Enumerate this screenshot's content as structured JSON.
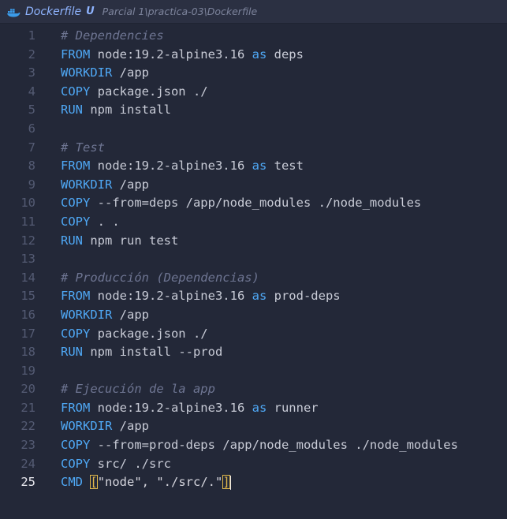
{
  "tab": {
    "filename": "Dockerfile",
    "status": "U",
    "path": "Parcial 1\\practica-03\\Dockerfile"
  },
  "active_line": 25,
  "lines": [
    {
      "n": "1",
      "parts": [
        {
          "t": "cm",
          "v": "# Dependencies"
        }
      ]
    },
    {
      "n": "2",
      "parts": [
        {
          "t": "kw",
          "v": "FROM"
        },
        {
          "t": "txt",
          "v": " node:19.2-alpine3.16 "
        },
        {
          "t": "kw",
          "v": "as"
        },
        {
          "t": "txt",
          "v": " deps"
        }
      ]
    },
    {
      "n": "3",
      "parts": [
        {
          "t": "kw",
          "v": "WORKDIR"
        },
        {
          "t": "txt",
          "v": " /app"
        }
      ]
    },
    {
      "n": "4",
      "parts": [
        {
          "t": "kw",
          "v": "COPY"
        },
        {
          "t": "txt",
          "v": " package.json ./"
        }
      ]
    },
    {
      "n": "5",
      "parts": [
        {
          "t": "kw",
          "v": "RUN"
        },
        {
          "t": "txt",
          "v": " npm install"
        }
      ]
    },
    {
      "n": "6",
      "parts": []
    },
    {
      "n": "7",
      "parts": [
        {
          "t": "cm",
          "v": "# Test"
        }
      ]
    },
    {
      "n": "8",
      "parts": [
        {
          "t": "kw",
          "v": "FROM"
        },
        {
          "t": "txt",
          "v": " node:19.2-alpine3.16 "
        },
        {
          "t": "kw",
          "v": "as"
        },
        {
          "t": "txt",
          "v": " test"
        }
      ]
    },
    {
      "n": "9",
      "parts": [
        {
          "t": "kw",
          "v": "WORKDIR"
        },
        {
          "t": "txt",
          "v": " /app"
        }
      ]
    },
    {
      "n": "10",
      "parts": [
        {
          "t": "kw",
          "v": "COPY"
        },
        {
          "t": "txt",
          "v": " --from=deps /app/node_modules ./node_modules"
        }
      ]
    },
    {
      "n": "11",
      "parts": [
        {
          "t": "kw",
          "v": "COPY"
        },
        {
          "t": "txt",
          "v": " . ."
        }
      ]
    },
    {
      "n": "12",
      "parts": [
        {
          "t": "kw",
          "v": "RUN"
        },
        {
          "t": "txt",
          "v": " npm run test"
        }
      ]
    },
    {
      "n": "13",
      "parts": []
    },
    {
      "n": "14",
      "parts": [
        {
          "t": "cm",
          "v": "# Producción (Dependencias)"
        }
      ]
    },
    {
      "n": "15",
      "parts": [
        {
          "t": "kw",
          "v": "FROM"
        },
        {
          "t": "txt",
          "v": " node:19.2-alpine3.16 "
        },
        {
          "t": "kw",
          "v": "as"
        },
        {
          "t": "txt",
          "v": " prod-deps"
        }
      ]
    },
    {
      "n": "16",
      "parts": [
        {
          "t": "kw",
          "v": "WORKDIR"
        },
        {
          "t": "txt",
          "v": " /app"
        }
      ]
    },
    {
      "n": "17",
      "parts": [
        {
          "t": "kw",
          "v": "COPY"
        },
        {
          "t": "txt",
          "v": " package.json ./"
        }
      ]
    },
    {
      "n": "18",
      "parts": [
        {
          "t": "kw",
          "v": "RUN"
        },
        {
          "t": "txt",
          "v": " npm install --prod"
        }
      ]
    },
    {
      "n": "19",
      "parts": []
    },
    {
      "n": "20",
      "parts": [
        {
          "t": "cm",
          "v": "# Ejecución de la app"
        }
      ]
    },
    {
      "n": "21",
      "parts": [
        {
          "t": "kw",
          "v": "FROM"
        },
        {
          "t": "txt",
          "v": " node:19.2-alpine3.16 "
        },
        {
          "t": "kw",
          "v": "as"
        },
        {
          "t": "txt",
          "v": " runner"
        }
      ]
    },
    {
      "n": "22",
      "parts": [
        {
          "t": "kw",
          "v": "WORKDIR"
        },
        {
          "t": "txt",
          "v": " /app"
        }
      ]
    },
    {
      "n": "23",
      "parts": [
        {
          "t": "kw",
          "v": "COPY"
        },
        {
          "t": "txt",
          "v": " --from=prod-deps /app/node_modules ./node_modules"
        }
      ]
    },
    {
      "n": "24",
      "parts": [
        {
          "t": "kw",
          "v": "COPY"
        },
        {
          "t": "txt",
          "v": " src/ ./src"
        }
      ]
    },
    {
      "n": "25",
      "parts": [
        {
          "t": "kw",
          "v": "CMD"
        },
        {
          "t": "txt",
          "v": " "
        },
        {
          "t": "br",
          "v": "["
        },
        {
          "t": "str",
          "v": "\"node\", \"./src/.\""
        },
        {
          "t": "br-cursor",
          "v": "]"
        }
      ]
    }
  ]
}
